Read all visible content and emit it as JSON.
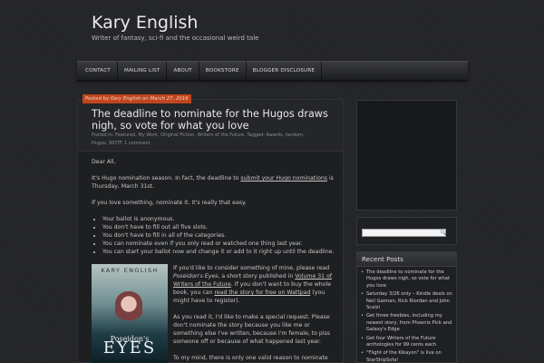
{
  "site": {
    "title": "Kary English",
    "tagline": "Writer of fantasy, sci-fi and the occasional weird tale"
  },
  "nav": [
    "CONTACT",
    "MAILING LIST",
    "ABOUT",
    "BOOKSTORE",
    "BLOGGER DISCLOSURE"
  ],
  "post": {
    "posted_by_prefix": "Posted by ",
    "author": "Kary English",
    "on_word": " on ",
    "date": "March 27, 2016",
    "title": "The deadline to nominate for the Hugos draws nigh, so vote for what you love",
    "meta_line1": "Posted in: Featured, My Work, Original Fiction, Writers of the Future. Tagged: Awards, fandom,",
    "meta_line2_tags": "Hugos, WOTF.",
    "meta_comments": "1 comment",
    "greeting": "Dear All,",
    "p1_start": "It's Hugo nomination season. In fact, the deadline to ",
    "p1_link": "submit your Hugo nominations",
    "p1_end": " is Thursday, March 31st.",
    "p2": "If you love something, nominate it. It's really that easy.",
    "bullets": [
      "Your ballot is anonymous.",
      "You don't have to fill out all five slots.",
      "You don't have to fill in all of the categories.",
      "You can nominate even if you only read or watched one thing last year.",
      "You can start your ballot now and change it or add to it right up until the deadline."
    ],
    "book_p1_a": "If you'd like to consider something of mine, please read ",
    "book_p1_title": "Poseidon's Eyes",
    "book_p1_b": ", a short story published in ",
    "book_p1_link1": "Volume 31 of Writers of the Future",
    "book_p1_c": ". If you don't want to buy the whole book, you can ",
    "book_p1_link2": "read the story for free on Wattpad",
    "book_p1_d": " (you might have to register).",
    "book_p2": "As you read it, I'd like to make a special request. Please don't nominate the story because you like me or something else I've written, because I'm female, to piss someone off or because of what happened last year.",
    "book_p3": "To my mind, there is only one valid reason to nominate"
  },
  "book_cover": {
    "author": "KARY ENGLISH",
    "title_small": "Poseidon's",
    "title_large": "EYES"
  },
  "sidebar": {
    "recent_title": "Recent Posts",
    "recent": [
      "The deadline to nominate for the Hugos draws nigh, so vote for what you love",
      "Saturday 3/26 only – Kindle deals on Neil Gaiman, Rick Riordan and John Scalzi",
      "Get three freebies, including my newest story, from Phoenix Pick and Galaxy's Edge",
      "Get four Writers of the Future anthologies for 99 cents each",
      "\"Flight of the Kikayon\" is live on StarShipSofa!"
    ]
  }
}
